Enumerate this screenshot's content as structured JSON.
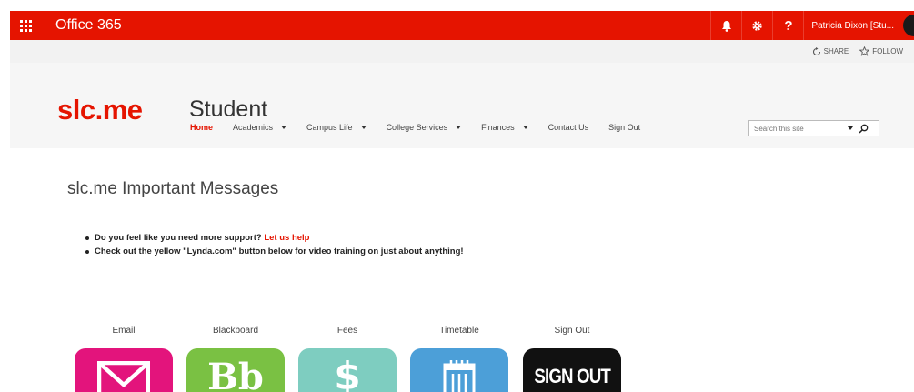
{
  "suite_bar": {
    "title": "Office 365",
    "user_name": "Patricia Dixon [Stu...",
    "help_label": "?"
  },
  "action_bar": {
    "share_label": "SHARE",
    "follow_label": "FOLLOW"
  },
  "site": {
    "logo_text": "slc.me",
    "title": "Student"
  },
  "nav": {
    "items": [
      {
        "label": "Home"
      },
      {
        "label": "Academics"
      },
      {
        "label": "Campus Life"
      },
      {
        "label": "College Services"
      },
      {
        "label": "Finances"
      },
      {
        "label": "Contact Us"
      },
      {
        "label": "Sign Out"
      }
    ]
  },
  "search": {
    "placeholder": "Search this site"
  },
  "content": {
    "heading": "slc.me Important Messages",
    "messages": [
      {
        "text": "Do you feel like you need more support?",
        "link": "Let us help"
      },
      {
        "text": "Check out the yellow \"Lynda.com\" button below for video training on just about anything!"
      }
    ]
  },
  "tiles": [
    {
      "label": "Email",
      "icon": "envelope-icon",
      "color": "#e3147c"
    },
    {
      "label": "Blackboard",
      "icon": "blackboard-logo-icon",
      "color": "#7ac143",
      "icon_text": "Bb"
    },
    {
      "label": "Fees",
      "icon": "dollar-icon",
      "color": "#7ecdc0",
      "icon_text": "$"
    },
    {
      "label": "Timetable",
      "icon": "calendar-icon",
      "color": "#4c9fd8"
    },
    {
      "label": "Sign Out",
      "icon": "sign-out-icon",
      "color": "#111111",
      "icon_text": "SIGN OUT"
    }
  ],
  "colors": {
    "brand_red": "#e51400"
  }
}
